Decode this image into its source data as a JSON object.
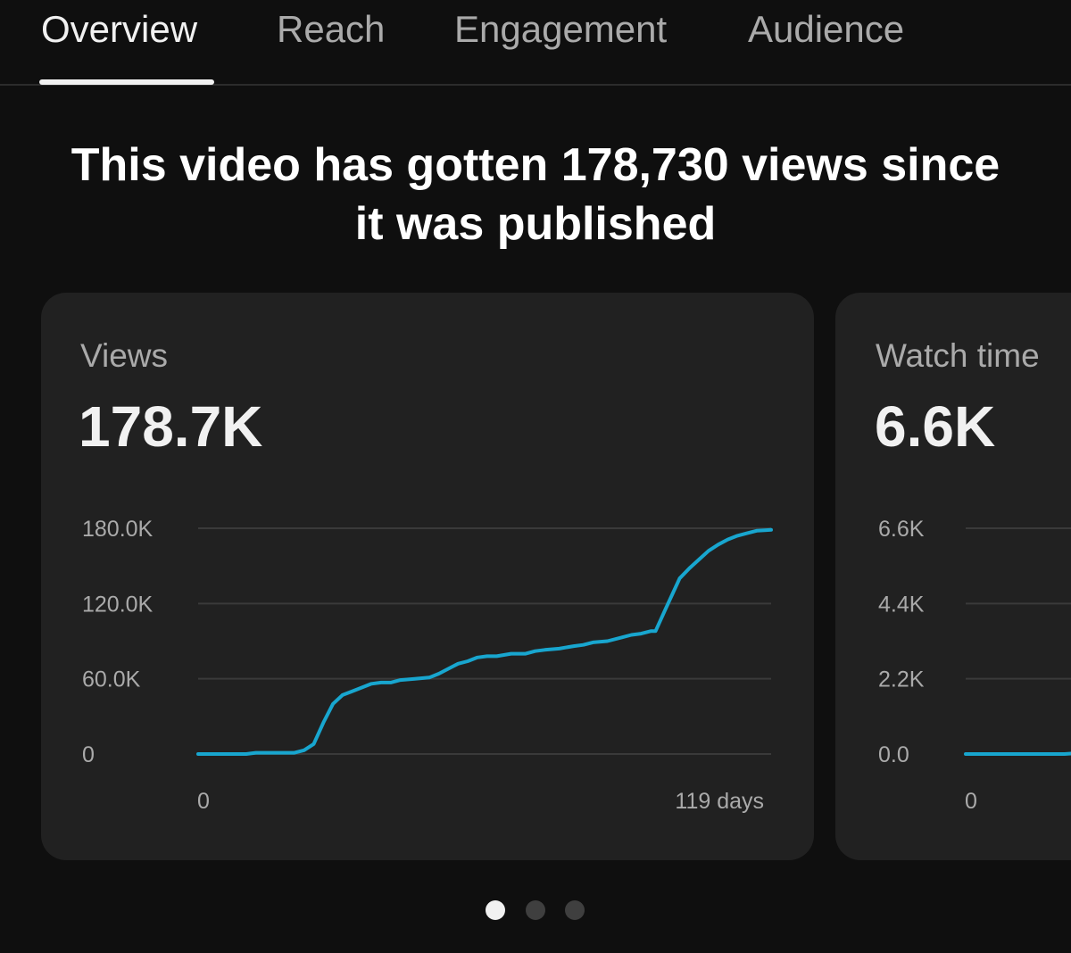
{
  "tabs": [
    {
      "label": "Overview",
      "active": true
    },
    {
      "label": "Reach",
      "active": false
    },
    {
      "label": "Engagement",
      "active": false
    },
    {
      "label": "Audience",
      "active": false
    }
  ],
  "headline": {
    "line1": "This video has gotten 178,730 views since",
    "line2": "it was published"
  },
  "cards": [
    {
      "label": "Views",
      "value": "178.7K"
    },
    {
      "label": "Watch time",
      "value": "6.6K"
    }
  ],
  "colors": {
    "line": "#18a6cf",
    "grid": "#3a3a3a",
    "card_bg": "#212121",
    "page_bg": "#0f0f0f"
  },
  "pager": {
    "count": 3,
    "active_index": 0
  },
  "chart_data": [
    {
      "type": "line",
      "ylim": [
        0,
        180000
      ],
      "xlim": [
        0,
        119
      ],
      "ytick_labels": [
        "0",
        "60.0K",
        "120.0K",
        "180.0K"
      ],
      "ytick_values": [
        0,
        60000,
        120000,
        180000
      ],
      "xtick_labels": [
        "0",
        "119 days"
      ],
      "xtick_values": [
        0,
        119
      ],
      "grid": true,
      "x": [
        0,
        5,
        10,
        12,
        15,
        20,
        22,
        24,
        26,
        28,
        30,
        32,
        34,
        36,
        38,
        40,
        42,
        45,
        48,
        50,
        52,
        54,
        56,
        58,
        60,
        62,
        65,
        68,
        70,
        72,
        75,
        78,
        80,
        82,
        85,
        88,
        90,
        92,
        94,
        95,
        97,
        100,
        102,
        104,
        106,
        108,
        110,
        112,
        114,
        116,
        118,
        119
      ],
      "y": [
        0,
        0,
        0,
        1000,
        1000,
        1000,
        3000,
        8000,
        25000,
        40000,
        47000,
        50000,
        53000,
        56000,
        57000,
        57000,
        59000,
        60000,
        61000,
        64000,
        68000,
        72000,
        74000,
        77000,
        78000,
        78000,
        80000,
        80000,
        82000,
        83000,
        84000,
        86000,
        87000,
        89000,
        90000,
        93000,
        95000,
        96000,
        98000,
        98000,
        115000,
        140000,
        148000,
        155000,
        162000,
        167000,
        171000,
        174000,
        176000,
        178000,
        178500,
        178700
      ]
    },
    {
      "type": "line",
      "ylim": [
        0,
        6600
      ],
      "ytick_labels": [
        "0.0",
        "2.2K",
        "4.4K",
        "6.6K"
      ],
      "ytick_values": [
        0,
        2200,
        4400,
        6600
      ],
      "xtick_labels": [
        "0"
      ],
      "xtick_values": [
        0
      ],
      "grid": true,
      "x": [
        0,
        5,
        10,
        12,
        15,
        20,
        22
      ],
      "y": [
        0,
        0,
        0,
        40,
        40,
        40,
        100
      ]
    }
  ]
}
